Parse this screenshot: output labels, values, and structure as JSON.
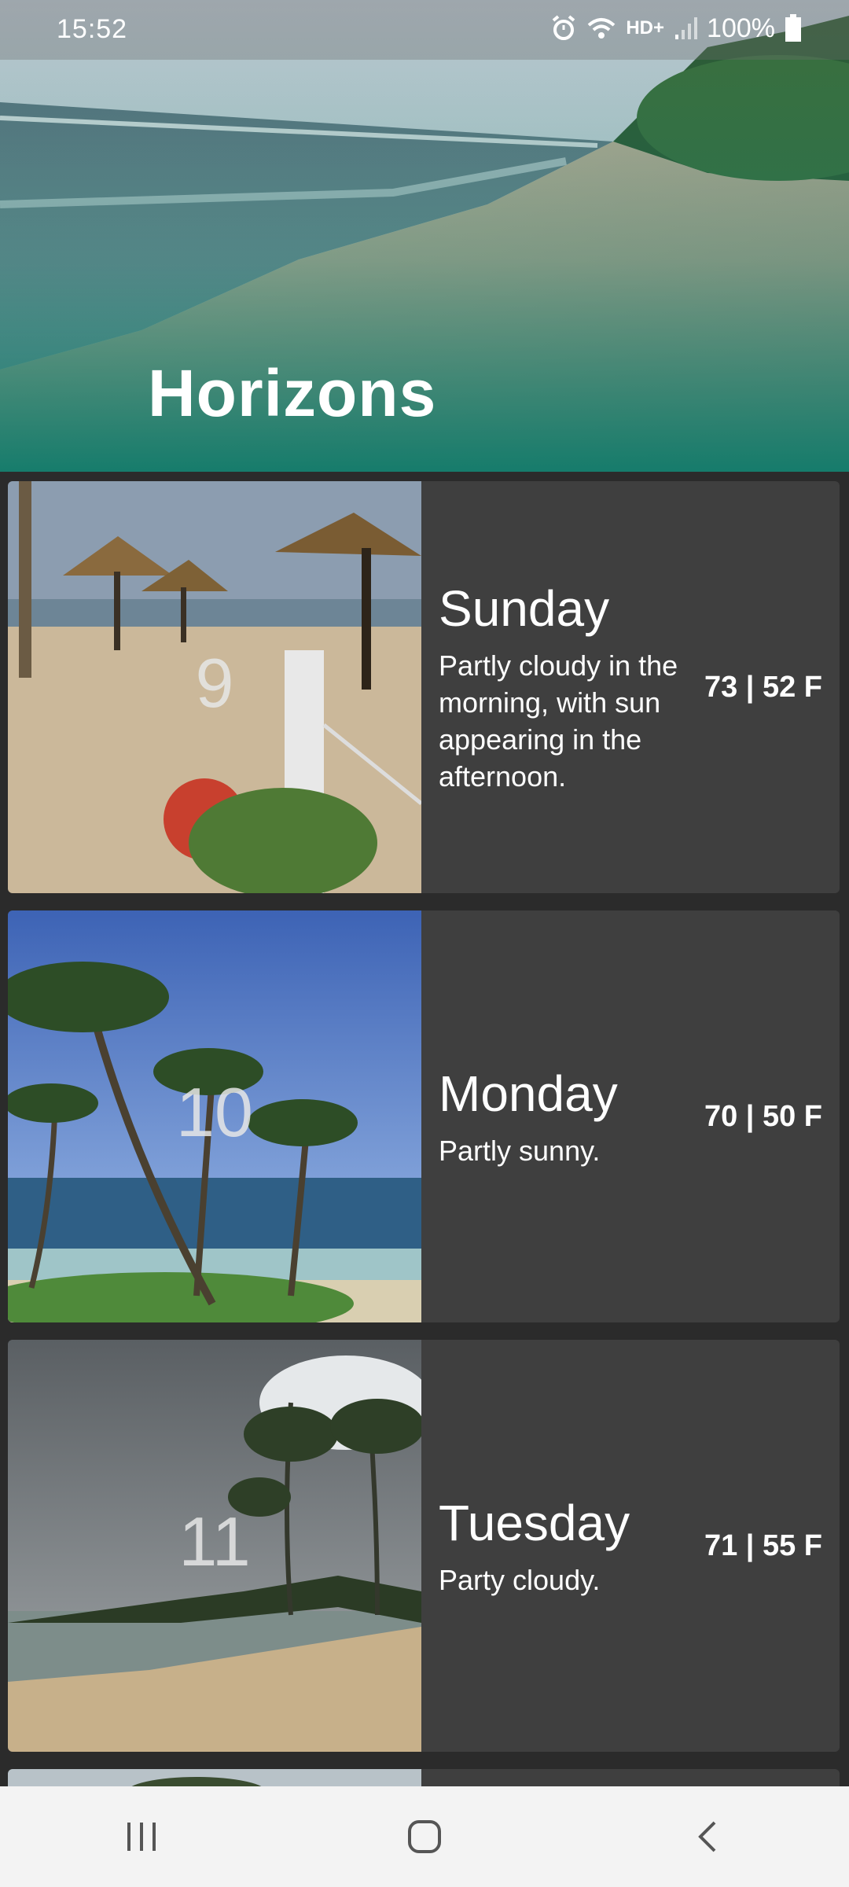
{
  "status_bar": {
    "time": "15:52",
    "network": "HD+",
    "battery": "100%"
  },
  "app": {
    "title": "Horizons"
  },
  "days": [
    {
      "date": "9",
      "name": "Sunday",
      "description": "Partly cloudy in the morning, with sun appearing in the afternoon.",
      "temperature": "73 | 52 F"
    },
    {
      "date": "10",
      "name": "Monday",
      "description": "Partly sunny.",
      "temperature": "70 | 50 F"
    },
    {
      "date": "11",
      "name": "Tuesday",
      "description": "Party cloudy.",
      "temperature": "71 | 55 F"
    }
  ],
  "nav_bar": {
    "icons": [
      "recent-apps-icon",
      "home-icon",
      "back-icon"
    ],
    "background": "#f3f3f3"
  },
  "colors": {
    "background": "#2b2b2b",
    "card": "#3f3f3f",
    "hero_gradient": "#0e7a6a"
  }
}
